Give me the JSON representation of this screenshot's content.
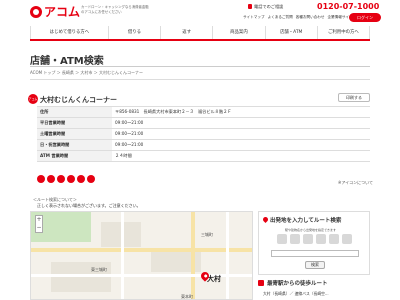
{
  "header": {
    "logo": "アコム",
    "tagline": "カードローン・キャッシングなら消費者金融のアコムにお任せください",
    "phone_label": "電話でのご相談",
    "phone_number": "0120-07-1000",
    "links": [
      "サイトマップ",
      "よくあるご質問",
      "各種お問い合わせ",
      "企業情報サイト"
    ],
    "login": "ログイン"
  },
  "nav": [
    "はじめて借りる方へ",
    "借りる",
    "返す",
    "商品案内",
    "店舗・ATM",
    "ご利用中の方へ"
  ],
  "page_title": "店舗・ATM検索",
  "breadcrumb": "ACOM トップ ＞ 長崎県 ＞ 大村市 ＞ 大村むじんくんコーナー",
  "store": {
    "badge": "アコム",
    "name": "大村むじんくんコーナー",
    "print": "印刷する",
    "rows": [
      {
        "label": "住所",
        "value": "〒856-0831　長崎県大村市東本町２－３　福谷ビル８階２Ｆ"
      },
      {
        "label": "平日営業時間",
        "value": "09:00～21:00"
      },
      {
        "label": "土曜営業時間",
        "value": "09:00～21:00"
      },
      {
        "label": "日・祝営業時間",
        "value": "09:00～21:00"
      },
      {
        "label": "ATM 営業時間",
        "value": "２４時間"
      }
    ],
    "icon_note": "※アイコンについて"
  },
  "route": {
    "label": "＜ルート検索について＞",
    "note": "正しく表示されない場合がございます。ご注意ください。",
    "box_title": "出発地を入力してルート検索",
    "box_desc": "駅や建物名から出発地を指定できます",
    "search_btn": "検索"
  },
  "map": {
    "labels": [
      "東三城町",
      "大村",
      "東本町",
      "三城町"
    ]
  },
  "station": {
    "title": "最寄駅からの徒歩ルート",
    "row": "大村（長崎県）／ 速線バス（長崎空..."
  }
}
